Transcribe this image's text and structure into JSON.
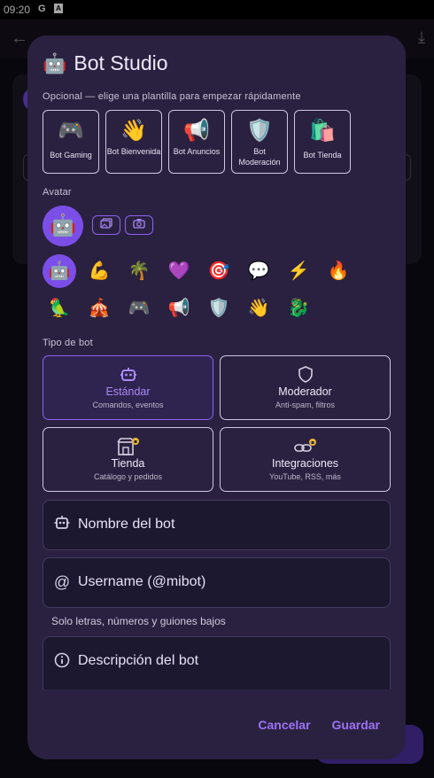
{
  "status_bar": {
    "time": "09:20",
    "icons": [
      "G",
      "A"
    ]
  },
  "background": {
    "back_icon": "arrow-left-icon",
    "download_icon": "download-icon"
  },
  "dialog": {
    "title_emoji": "🤖",
    "title": "Bot Studio",
    "template_hint": "Opcional — elige una plantilla para empezar rápidamente",
    "templates": [
      {
        "emoji": "🎮",
        "label": "Bot Gaming"
      },
      {
        "emoji": "👋",
        "label": "Bot Bienvenida"
      },
      {
        "emoji": "📢",
        "label": "Bot Anuncios"
      },
      {
        "emoji": "🛡️",
        "label": "Bot Moderación"
      },
      {
        "emoji": "🛍️",
        "label": "Bot Tienda"
      }
    ],
    "avatar_label": "Avatar",
    "avatar_emoji": "🤖",
    "avatar_buttons": [
      "gallery-icon",
      "camera-icon"
    ],
    "emoji_options": [
      "🤖",
      "💪",
      "🌴",
      "💜",
      "🎯",
      "💬",
      "⚡",
      "🔥",
      "🦜",
      "🎪",
      "🎮",
      "📢",
      "🛡️",
      "👋",
      "🐉"
    ],
    "selected_emoji_index": 0,
    "bot_type_label": "Tipo de bot",
    "bot_types": [
      {
        "title": "Estándar",
        "subtitle": "Comandos, eventos",
        "icon": "robot-icon",
        "selected": true
      },
      {
        "title": "Moderador",
        "subtitle": "Anti-spam, filtros",
        "icon": "shield-icon",
        "selected": false
      },
      {
        "title": "Tienda",
        "subtitle": "Catálogo y pedidos",
        "icon": "store-icon",
        "selected": false
      },
      {
        "title": "Integraciones",
        "subtitle": "YouTube, RSS, más",
        "icon": "link-icon",
        "selected": false
      }
    ],
    "fields": {
      "name_placeholder": "Nombre del bot",
      "username_placeholder": "Username (@mibot)",
      "username_helper": "Solo letras, números y guiones bajos",
      "description_placeholder": "Descripción del bot"
    },
    "actions": {
      "cancel": "Cancelar",
      "save": "Guardar"
    },
    "colors": {
      "accent": "#8b62f0",
      "surface": "#2a2140"
    }
  }
}
